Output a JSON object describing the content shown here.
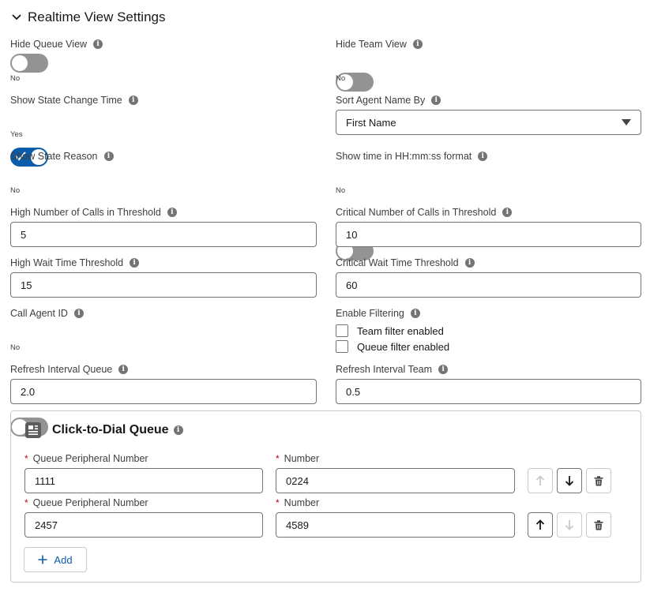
{
  "section": {
    "title": "Realtime View Settings"
  },
  "settings": {
    "hide_queue_view": {
      "label": "Hide Queue View",
      "state": "No"
    },
    "hide_team_view": {
      "label": "Hide Team View",
      "state": "No"
    },
    "show_state_change_time": {
      "label": "Show State Change Time",
      "state": "Yes"
    },
    "sort_agent_name_by": {
      "label": "Sort Agent Name By",
      "value": "First Name"
    },
    "show_state_reason": {
      "label": "Show State Reason",
      "state": "No"
    },
    "show_time_format": {
      "label": "Show time in HH:mm:ss format",
      "state": "No"
    },
    "high_calls_threshold": {
      "label": "High Number of Calls in Threshold",
      "value": "5"
    },
    "critical_calls_threshold": {
      "label": "Critical Number of Calls in Threshold",
      "value": "10"
    },
    "high_wait_threshold": {
      "label": "High Wait Time Threshold",
      "value": "15"
    },
    "critical_wait_threshold": {
      "label": "Critical Wait Time Threshold",
      "value": "60"
    },
    "call_agent_id": {
      "label": "Call Agent ID",
      "state": "No"
    },
    "enable_filtering": {
      "label": "Enable Filtering",
      "options": [
        "Team filter enabled",
        "Queue filter enabled"
      ]
    },
    "refresh_interval_queue": {
      "label": "Refresh Interval Queue",
      "value": "2.0"
    },
    "refresh_interval_team": {
      "label": "Refresh Interval Team",
      "value": "0.5"
    }
  },
  "click_to_dial": {
    "title": "Click-to-Dial Queue",
    "rows": [
      {
        "peripheral_label": "Queue Peripheral Number",
        "peripheral_value": "1111",
        "number_label": "Number",
        "number_value": "0224"
      },
      {
        "peripheral_label": "Queue Peripheral Number",
        "peripheral_value": "2457",
        "number_label": "Number",
        "number_value": "4589"
      }
    ],
    "required_marker": "*",
    "add_label": "Add"
  },
  "colors": {
    "accent": "#0b5cab",
    "toggle_off": "#939393",
    "required": "#ba0517",
    "border": "#747474"
  }
}
